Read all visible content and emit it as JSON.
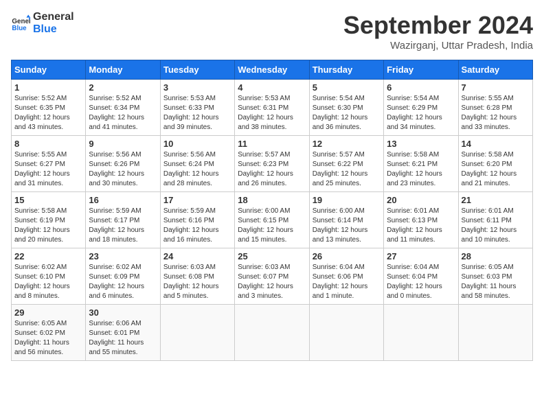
{
  "header": {
    "logo_line1": "General",
    "logo_line2": "Blue",
    "month": "September 2024",
    "location": "Wazirganj, Uttar Pradesh, India"
  },
  "days_of_week": [
    "Sunday",
    "Monday",
    "Tuesday",
    "Wednesday",
    "Thursday",
    "Friday",
    "Saturday"
  ],
  "weeks": [
    [
      {
        "day": "1",
        "info": "Sunrise: 5:52 AM\nSunset: 6:35 PM\nDaylight: 12 hours\nand 43 minutes."
      },
      {
        "day": "2",
        "info": "Sunrise: 5:52 AM\nSunset: 6:34 PM\nDaylight: 12 hours\nand 41 minutes."
      },
      {
        "day": "3",
        "info": "Sunrise: 5:53 AM\nSunset: 6:33 PM\nDaylight: 12 hours\nand 39 minutes."
      },
      {
        "day": "4",
        "info": "Sunrise: 5:53 AM\nSunset: 6:31 PM\nDaylight: 12 hours\nand 38 minutes."
      },
      {
        "day": "5",
        "info": "Sunrise: 5:54 AM\nSunset: 6:30 PM\nDaylight: 12 hours\nand 36 minutes."
      },
      {
        "day": "6",
        "info": "Sunrise: 5:54 AM\nSunset: 6:29 PM\nDaylight: 12 hours\nand 34 minutes."
      },
      {
        "day": "7",
        "info": "Sunrise: 5:55 AM\nSunset: 6:28 PM\nDaylight: 12 hours\nand 33 minutes."
      }
    ],
    [
      {
        "day": "8",
        "info": "Sunrise: 5:55 AM\nSunset: 6:27 PM\nDaylight: 12 hours\nand 31 minutes."
      },
      {
        "day": "9",
        "info": "Sunrise: 5:56 AM\nSunset: 6:26 PM\nDaylight: 12 hours\nand 30 minutes."
      },
      {
        "day": "10",
        "info": "Sunrise: 5:56 AM\nSunset: 6:24 PM\nDaylight: 12 hours\nand 28 minutes."
      },
      {
        "day": "11",
        "info": "Sunrise: 5:57 AM\nSunset: 6:23 PM\nDaylight: 12 hours\nand 26 minutes."
      },
      {
        "day": "12",
        "info": "Sunrise: 5:57 AM\nSunset: 6:22 PM\nDaylight: 12 hours\nand 25 minutes."
      },
      {
        "day": "13",
        "info": "Sunrise: 5:58 AM\nSunset: 6:21 PM\nDaylight: 12 hours\nand 23 minutes."
      },
      {
        "day": "14",
        "info": "Sunrise: 5:58 AM\nSunset: 6:20 PM\nDaylight: 12 hours\nand 21 minutes."
      }
    ],
    [
      {
        "day": "15",
        "info": "Sunrise: 5:58 AM\nSunset: 6:19 PM\nDaylight: 12 hours\nand 20 minutes."
      },
      {
        "day": "16",
        "info": "Sunrise: 5:59 AM\nSunset: 6:17 PM\nDaylight: 12 hours\nand 18 minutes."
      },
      {
        "day": "17",
        "info": "Sunrise: 5:59 AM\nSunset: 6:16 PM\nDaylight: 12 hours\nand 16 minutes."
      },
      {
        "day": "18",
        "info": "Sunrise: 6:00 AM\nSunset: 6:15 PM\nDaylight: 12 hours\nand 15 minutes."
      },
      {
        "day": "19",
        "info": "Sunrise: 6:00 AM\nSunset: 6:14 PM\nDaylight: 12 hours\nand 13 minutes."
      },
      {
        "day": "20",
        "info": "Sunrise: 6:01 AM\nSunset: 6:13 PM\nDaylight: 12 hours\nand 11 minutes."
      },
      {
        "day": "21",
        "info": "Sunrise: 6:01 AM\nSunset: 6:11 PM\nDaylight: 12 hours\nand 10 minutes."
      }
    ],
    [
      {
        "day": "22",
        "info": "Sunrise: 6:02 AM\nSunset: 6:10 PM\nDaylight: 12 hours\nand 8 minutes."
      },
      {
        "day": "23",
        "info": "Sunrise: 6:02 AM\nSunset: 6:09 PM\nDaylight: 12 hours\nand 6 minutes."
      },
      {
        "day": "24",
        "info": "Sunrise: 6:03 AM\nSunset: 6:08 PM\nDaylight: 12 hours\nand 5 minutes."
      },
      {
        "day": "25",
        "info": "Sunrise: 6:03 AM\nSunset: 6:07 PM\nDaylight: 12 hours\nand 3 minutes."
      },
      {
        "day": "26",
        "info": "Sunrise: 6:04 AM\nSunset: 6:06 PM\nDaylight: 12 hours\nand 1 minute."
      },
      {
        "day": "27",
        "info": "Sunrise: 6:04 AM\nSunset: 6:04 PM\nDaylight: 12 hours\nand 0 minutes."
      },
      {
        "day": "28",
        "info": "Sunrise: 6:05 AM\nSunset: 6:03 PM\nDaylight: 11 hours\nand 58 minutes."
      }
    ],
    [
      {
        "day": "29",
        "info": "Sunrise: 6:05 AM\nSunset: 6:02 PM\nDaylight: 11 hours\nand 56 minutes."
      },
      {
        "day": "30",
        "info": "Sunrise: 6:06 AM\nSunset: 6:01 PM\nDaylight: 11 hours\nand 55 minutes."
      },
      {
        "day": "",
        "info": ""
      },
      {
        "day": "",
        "info": ""
      },
      {
        "day": "",
        "info": ""
      },
      {
        "day": "",
        "info": ""
      },
      {
        "day": "",
        "info": ""
      }
    ]
  ]
}
